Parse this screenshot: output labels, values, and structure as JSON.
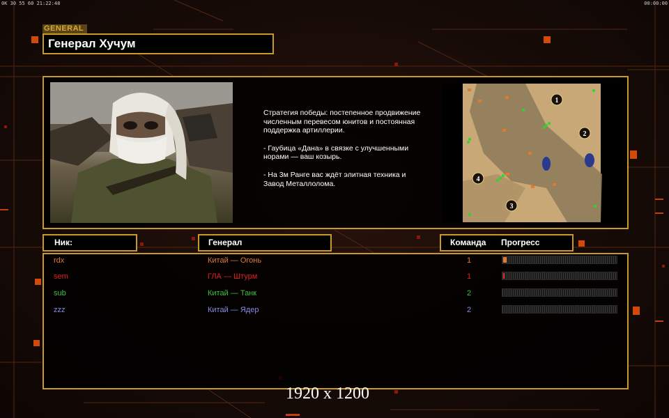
{
  "hud": {
    "left": "0K  30  55  60  21:22:48",
    "right": "00:00:00"
  },
  "header": {
    "tag": "GENERAL",
    "title": "Генерал Хучум"
  },
  "description": [
    "Стратегия победы: постепенное продвижение численным перевесом юнитов и постоянная поддержка артиллерии.",
    "- Гаубица «Дана» в связке с улучшенными норами — ваш козырь.",
    "- На 3м Ранге вас ждёт элитная техника и Завод Металлолома."
  ],
  "minimap": {
    "markers": [
      "1",
      "2",
      "3",
      "4"
    ]
  },
  "table": {
    "headers": {
      "nick": "Ник:",
      "general": "Генерал",
      "team": "Команда",
      "progress": "Прогресс"
    },
    "rows": [
      {
        "nick": "rdx",
        "general": "Китай — Огонь",
        "team": "1",
        "progress": 0.03,
        "color": "#e07a35"
      },
      {
        "nick": "sem",
        "general": "ГЛА — Штурм",
        "team": "1",
        "progress": 0.015,
        "color": "#e02020"
      },
      {
        "nick": "sub",
        "general": "Китай — Танк",
        "team": "2",
        "progress": 0.0,
        "color": "#3cc23c"
      },
      {
        "nick": "zzz",
        "general": "Китай — Ядер",
        "team": "2",
        "progress": 0.0,
        "color": "#8a8ae0"
      }
    ]
  },
  "resolution": "1920 x 1200"
}
